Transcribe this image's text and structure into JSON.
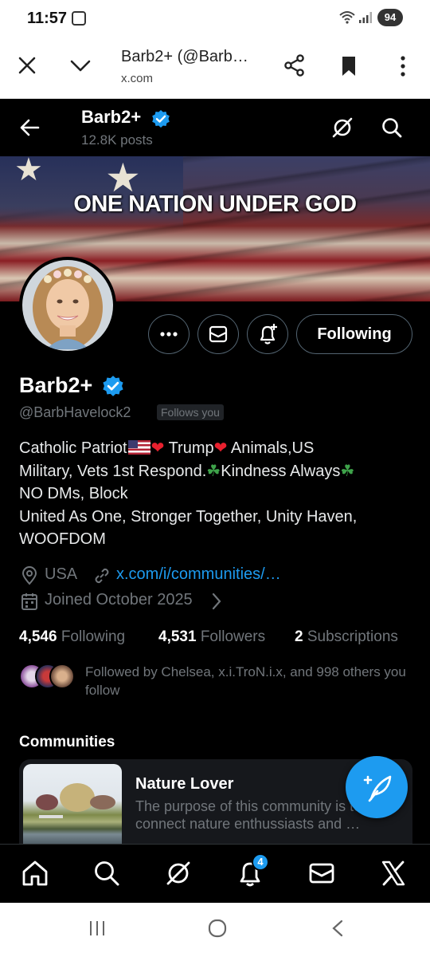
{
  "status_bar": {
    "time": "11:57",
    "battery": "94"
  },
  "browser": {
    "title": "Barb2+ (@Barb…",
    "url": "x.com"
  },
  "header": {
    "name": "Barb2+",
    "posts": "12.8K posts"
  },
  "banner": {
    "text": "ONE NATION UNDER GOD"
  },
  "profile": {
    "name": "Barb2+",
    "handle": "@BarbHavelock2",
    "follows_you": "Follows you",
    "follow_button": "Following",
    "bio": {
      "l1_a": "Catholic Patriot",
      "l1_b": " Trump",
      "l1_c": " Animals,US",
      "l2_a": "Military, Vets 1st Respond.",
      "l2_b": "Kindness Always",
      "l3": "NO DMs, Block",
      "l4": "United As One, Stronger Together, Unity Haven,",
      "l5": "WOOFDOM"
    },
    "location": "USA",
    "link": "x.com/i/communities/…",
    "joined": "Joined October 2025",
    "following_count": "4,546",
    "following_label": "Following",
    "followers_count": "4,531",
    "followers_label": "Followers",
    "subscriptions_count": "2",
    "subscriptions_label": "Subscriptions",
    "followed_by": "Followed by Chelsea, x.i.TroN.i.x, and 998 others you follow"
  },
  "communities": {
    "title": "Communities",
    "items": [
      {
        "name": "Nature Lover",
        "description": "The purpose of this community is to connect nature enthussiasts and …"
      }
    ]
  },
  "bottom_nav": {
    "notification_count": "4"
  },
  "colors": {
    "accent": "#1d9bf0",
    "background": "#000000",
    "secondary_text": "#71767b"
  }
}
